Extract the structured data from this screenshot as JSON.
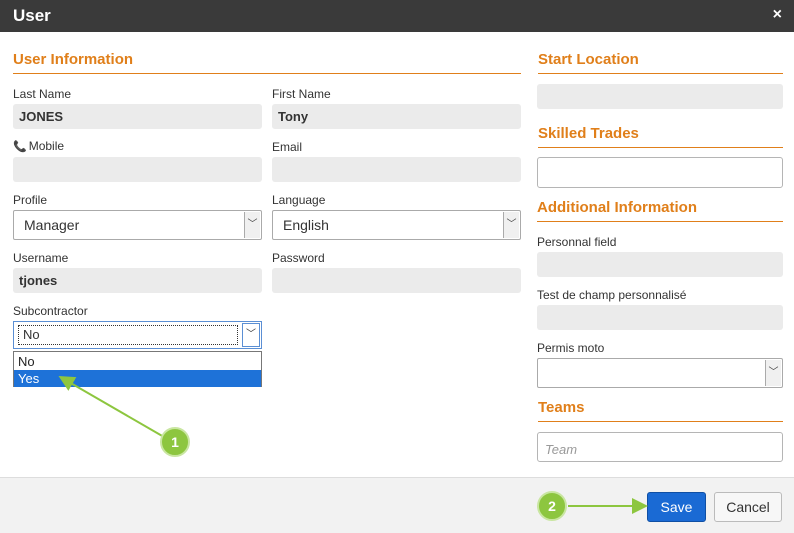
{
  "dialog": {
    "title": "User",
    "close_symbol": "×"
  },
  "user_info": {
    "heading": "User Information",
    "last_name": {
      "label": "Last Name",
      "value": "JONES"
    },
    "first_name": {
      "label": "First Name",
      "value": "Tony"
    },
    "mobile": {
      "label": "Mobile",
      "value": ""
    },
    "email": {
      "label": "Email",
      "value": ""
    },
    "profile": {
      "label": "Profile",
      "value": "Manager"
    },
    "language": {
      "label": "Language",
      "value": "English"
    },
    "username": {
      "label": "Username",
      "value": "tjones"
    },
    "password": {
      "label": "Password",
      "value": ""
    },
    "subcontractor": {
      "label": "Subcontractor",
      "value": "No",
      "options": [
        "No",
        "Yes"
      ],
      "highlighted": "Yes"
    }
  },
  "start_location": {
    "heading": "Start Location",
    "value": ""
  },
  "skilled_trades": {
    "heading": "Skilled Trades",
    "value": ""
  },
  "additional_info": {
    "heading": "Additional Information",
    "personnal_field": {
      "label": "Personnal field",
      "value": ""
    },
    "test_champ": {
      "label": "Test de champ personnalisé",
      "value": ""
    },
    "permis_moto": {
      "label": "Permis moto",
      "value": ""
    }
  },
  "teams": {
    "heading": "Teams",
    "placeholder": "Team"
  },
  "footer": {
    "save_label": "Save",
    "cancel_label": "Cancel"
  },
  "callouts": [
    "1",
    "2"
  ],
  "colors": {
    "accent": "#e07f1a",
    "primary_button": "#1a6ad4",
    "callout": "#8dc63f",
    "titlebar": "#3a3a3a"
  },
  "icons": {
    "mobile": "phone-icon",
    "close": "close-icon",
    "dropdown": "chevron-down-icon"
  }
}
